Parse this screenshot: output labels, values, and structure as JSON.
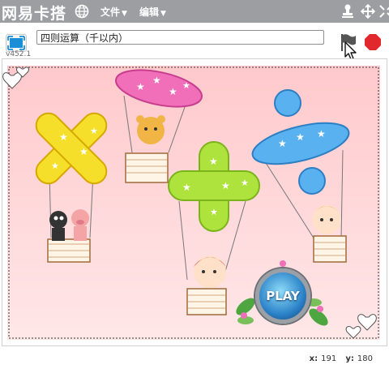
{
  "app": {
    "brand": "网易卡搭"
  },
  "menu": {
    "file": "文件",
    "edit": "编辑"
  },
  "stage": {
    "version": "v452.1",
    "project_title": "四则运算（千以内）",
    "play_label": "PLAY"
  },
  "status": {
    "x_label": "x:",
    "x_value": "191",
    "y_label": "y:",
    "y_value": "180"
  },
  "colors": {
    "menubar": "#9c9ea2",
    "stage_bg": "#ffd6d6",
    "stop": "#e0282d"
  },
  "icons": [
    "globe-icon",
    "stamp-icon",
    "expand-icon",
    "shrink-icon",
    "fullscreen-icon",
    "green-flag-icon",
    "stop-icon",
    "cursor-icon"
  ]
}
